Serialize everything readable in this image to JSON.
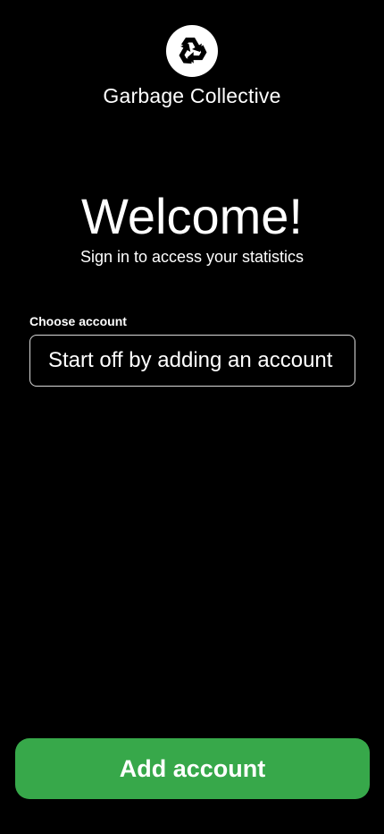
{
  "brand": {
    "logo_icon": "recycle-icon",
    "app_name": "Garbage Collective"
  },
  "hero": {
    "title": "Welcome!",
    "subtitle": "Sign in to access your statistics"
  },
  "account": {
    "label": "Choose account",
    "value": "Start off by adding an account"
  },
  "actions": {
    "add_account_label": "Add account"
  },
  "colors": {
    "background": "#000000",
    "accent": "#37a84a",
    "text": "#ffffff",
    "field_border": "#d9d9d9"
  }
}
